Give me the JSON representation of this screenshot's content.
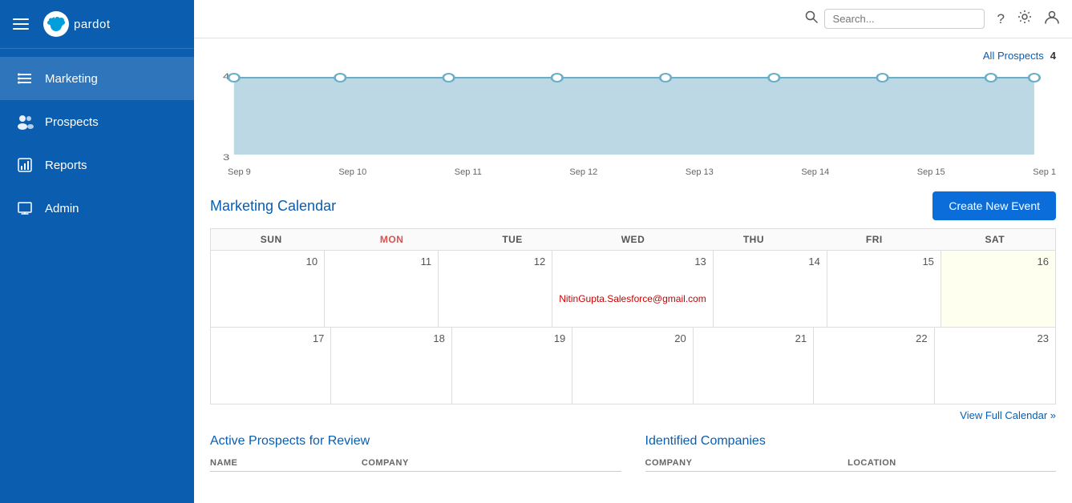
{
  "sidebar": {
    "items": [
      {
        "id": "marketing",
        "label": "Marketing",
        "icon": "marketing"
      },
      {
        "id": "prospects",
        "label": "Prospects",
        "icon": "prospects"
      },
      {
        "id": "reports",
        "label": "Reports",
        "icon": "reports"
      },
      {
        "id": "admin",
        "label": "Admin",
        "icon": "admin"
      }
    ]
  },
  "topbar": {
    "search_placeholder": "Search...",
    "help_label": "?",
    "settings_label": "⚙",
    "user_label": "👤"
  },
  "chart": {
    "y_max": "4",
    "y_min": "3",
    "x_labels": [
      "Sep 9",
      "Sep 10",
      "Sep 11",
      "Sep 12",
      "Sep 13",
      "Sep 14",
      "Sep 15",
      "Sep 1"
    ],
    "all_prospects_label": "All Prospects",
    "all_prospects_count": "4"
  },
  "calendar": {
    "title": "Marketing Calendar",
    "create_event_label": "Create New Event",
    "days_of_week": [
      "SUN",
      "MON",
      "TUE",
      "WED",
      "THU",
      "FRI",
      "SAT"
    ],
    "week1": [
      {
        "date": "10",
        "today": false,
        "event": ""
      },
      {
        "date": "11",
        "today": false,
        "event": ""
      },
      {
        "date": "12",
        "today": false,
        "event": ""
      },
      {
        "date": "13",
        "today": false,
        "event": "NitinGupta.Salesforce@gmail.com"
      },
      {
        "date": "14",
        "today": false,
        "event": ""
      },
      {
        "date": "15",
        "today": false,
        "event": ""
      },
      {
        "date": "16",
        "today": true,
        "event": ""
      }
    ],
    "week2": [
      {
        "date": "17",
        "today": false,
        "event": ""
      },
      {
        "date": "18",
        "today": false,
        "event": ""
      },
      {
        "date": "19",
        "today": false,
        "event": ""
      },
      {
        "date": "20",
        "today": false,
        "event": ""
      },
      {
        "date": "21",
        "today": false,
        "event": ""
      },
      {
        "date": "22",
        "today": false,
        "event": ""
      },
      {
        "date": "23",
        "today": false,
        "event": ""
      }
    ],
    "view_full_calendar_label": "View Full Calendar »"
  },
  "active_prospects": {
    "title": "Active Prospects for Review",
    "columns": [
      "NAME",
      "COMPANY"
    ],
    "rows": []
  },
  "identified_companies": {
    "title": "Identified Companies",
    "columns": [
      "COMPANY",
      "LOCATION"
    ],
    "rows": []
  }
}
